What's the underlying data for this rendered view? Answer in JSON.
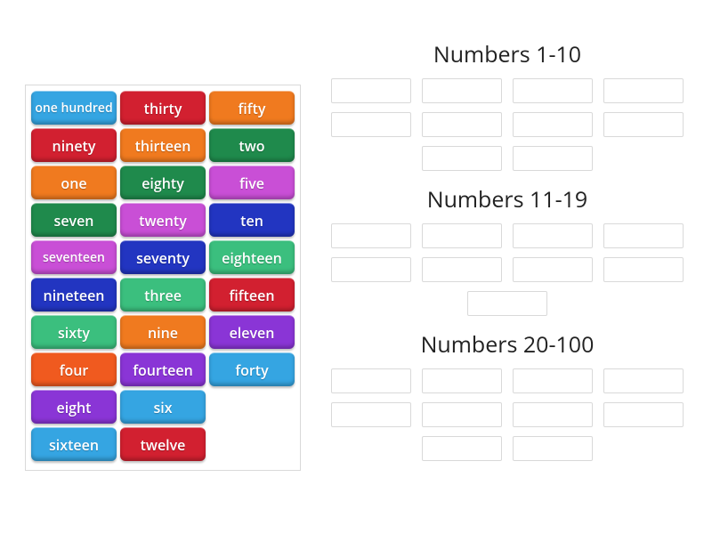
{
  "tiles": [
    {
      "label": "one hundred",
      "color": "#35a5e2",
      "small": true
    },
    {
      "label": "thirty",
      "color": "#d22030"
    },
    {
      "label": "fifty",
      "color": "#f07a1f"
    },
    {
      "label": "ninety",
      "color": "#d22030"
    },
    {
      "label": "thirteen",
      "color": "#f07a1f"
    },
    {
      "label": "two",
      "color": "#1f8a4c"
    },
    {
      "label": "one",
      "color": "#f07a1f"
    },
    {
      "label": "eighty",
      "color": "#1f8a4c"
    },
    {
      "label": "five",
      "color": "#c94fd6"
    },
    {
      "label": "seven",
      "color": "#1f8a4c"
    },
    {
      "label": "twenty",
      "color": "#c94fd6"
    },
    {
      "label": "ten",
      "color": "#2235c1"
    },
    {
      "label": "seventeen",
      "color": "#c94fd6",
      "small": true
    },
    {
      "label": "seventy",
      "color": "#2235c1"
    },
    {
      "label": "eighteen",
      "color": "#3bbf7e"
    },
    {
      "label": "nineteen",
      "color": "#2235c1"
    },
    {
      "label": "three",
      "color": "#3bbf7e"
    },
    {
      "label": "fifteen",
      "color": "#d22030"
    },
    {
      "label": "sixty",
      "color": "#3bbf7e"
    },
    {
      "label": "nine",
      "color": "#f07a1f"
    },
    {
      "label": "eleven",
      "color": "#8a35d6"
    },
    {
      "label": "four",
      "color": "#f05a1f"
    },
    {
      "label": "fourteen",
      "color": "#8a35d6"
    },
    {
      "label": "forty",
      "color": "#35a5e2"
    },
    {
      "label": "eight",
      "color": "#8a35d6"
    },
    {
      "label": "six",
      "color": "#35a5e2"
    },
    {
      "label": "",
      "color": ""
    },
    {
      "label": "sixteen",
      "color": "#35a5e2"
    },
    {
      "label": "twelve",
      "color": "#d22030"
    }
  ],
  "groups": [
    {
      "title": "Numbers 1-10",
      "slots": 10
    },
    {
      "title": "Numbers 11-19",
      "slots": 9
    },
    {
      "title": "Numbers 20-100",
      "slots": 10
    }
  ]
}
